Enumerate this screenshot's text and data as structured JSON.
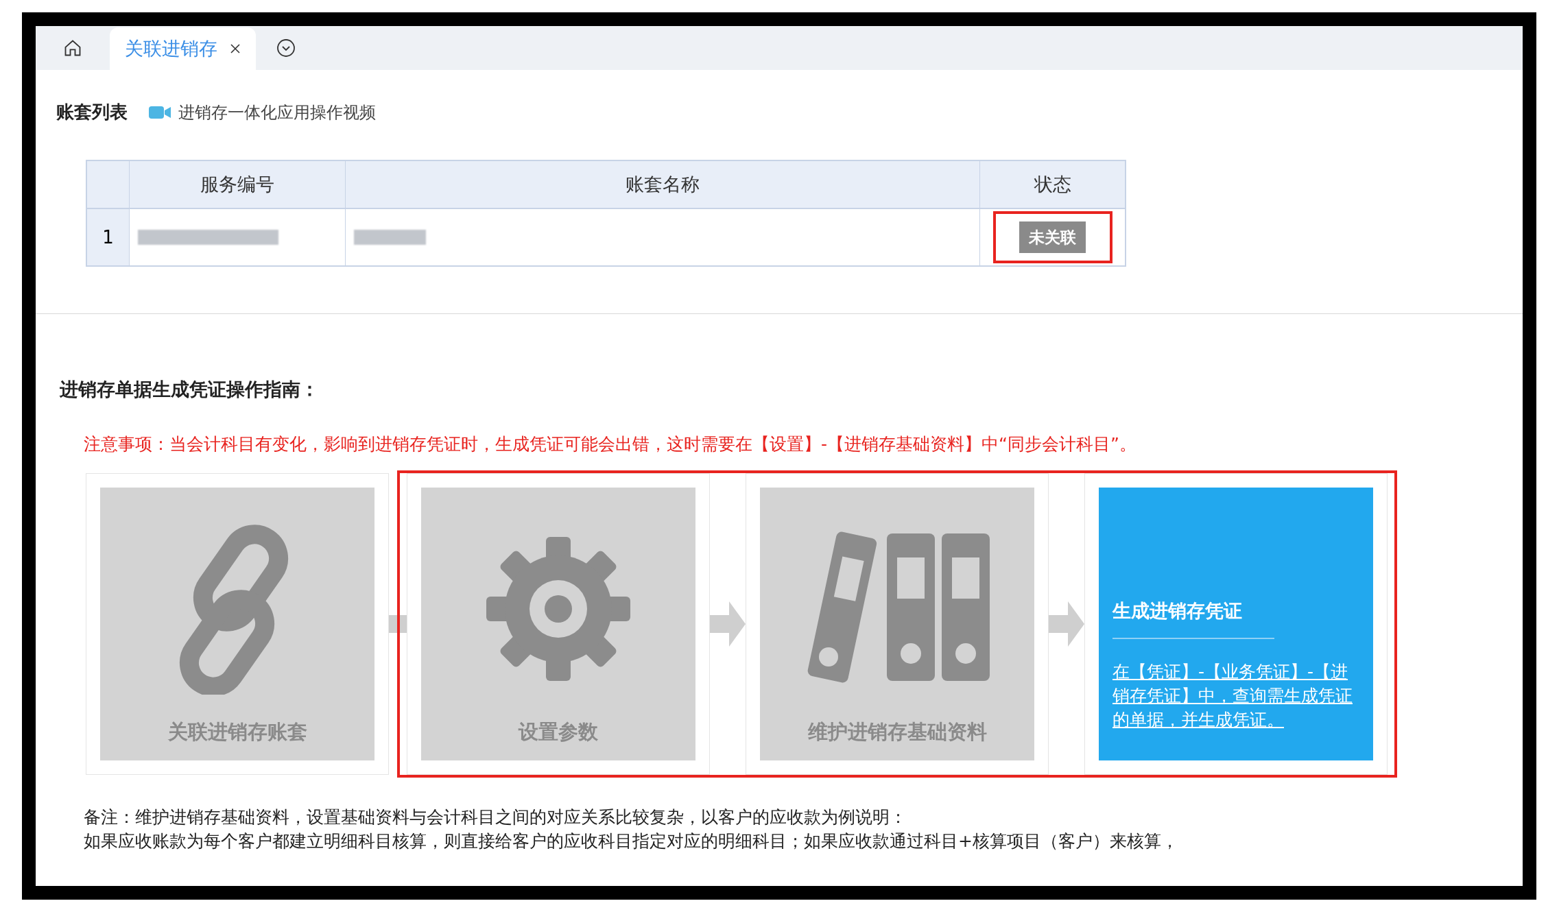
{
  "tabs": [
    {
      "label": "关联进销存",
      "selected": true
    }
  ],
  "account_list": {
    "title": "账套列表",
    "video_link": "进销存一体化应用操作视频"
  },
  "table": {
    "columns": [
      "服务编号",
      "账套名称",
      "状态"
    ],
    "rows": [
      {
        "index": "1",
        "status": "未关联",
        "highlighted": true
      }
    ]
  },
  "guide": {
    "title": "进销存单据生成凭证操作指南：",
    "notice": "注意事项：当会计科目有变化，影响到进销存凭证时，生成凭证可能会出错，这时需要在【设置】-【进销存基础资料】中“同步会计科目”。",
    "steps": [
      {
        "kind": "link",
        "label": "关联进销存账套",
        "highlighted": false
      },
      {
        "kind": "gear",
        "label": "设置参数",
        "highlighted": true
      },
      {
        "kind": "binders",
        "label": "维护进销存基础资料",
        "highlighted": true
      },
      {
        "kind": "action",
        "title": "生成进销存凭证",
        "text": "在【凭证】-【业务凭证】-【进销存凭证】中，查询需生成凭证的单据，并生成凭证。",
        "highlighted": true
      }
    ]
  },
  "note": [
    "备注：维护进销存基础资料，设置基础资料与会计科目之间的对应关系比较复杂，以客户的应收款为例说明：",
    "如果应收账款为每个客户都建立明细科目核算，则直接给客户的应收科目指定对应的明细科目；如果应收款通过科目+核算项目（客户）来核算，"
  ]
}
